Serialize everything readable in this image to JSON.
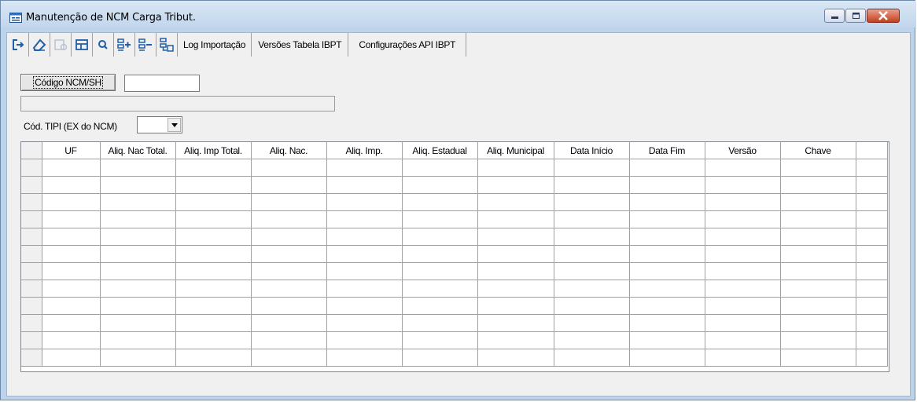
{
  "window": {
    "title": "Manutenção de NCM Carga Tribut.",
    "controls": [
      "minimize",
      "maximize",
      "close"
    ]
  },
  "toolbar": {
    "icons": [
      "exit-icon",
      "eraser-icon",
      "disabled-save-icon",
      "table-icon",
      "search-icon",
      "add-row-icon",
      "remove-row-icon",
      "import-icon"
    ],
    "buttons": {
      "log_importacao": "Log Importação",
      "versoes_tabela": "Versões Tabela IBPT",
      "config_api": "Configurações API IBPT"
    }
  },
  "form": {
    "ncm_button": "Código NCM/SH",
    "ncm_value": "",
    "description": "",
    "tipi_label": "Cód. TIPI (EX do NCM)",
    "tipi_value": ""
  },
  "grid": {
    "columns": [
      "UF",
      "Aliq. Nac Total.",
      "Aliq. Imp Total.",
      "Aliq. Nac.",
      "Aliq. Imp.",
      "Aliq. Estadual",
      "Aliq. Municipal",
      "Data Início",
      "Data Fim",
      "Versão",
      "Chave"
    ],
    "row_count": 12
  },
  "colors": {
    "titlebar": "#c9dcf0",
    "client": "#f0f0f0",
    "close_button": "#c2401d",
    "toolbar_icon": "#1f5fa8"
  }
}
